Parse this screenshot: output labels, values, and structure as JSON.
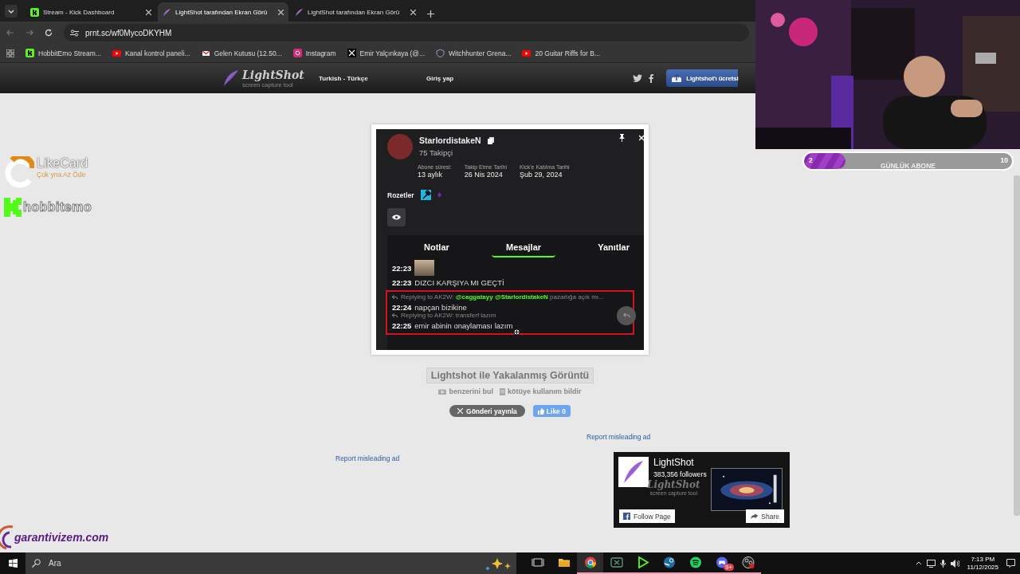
{
  "browser": {
    "tabs": [
      {
        "label": "Stream - Kick Dashboard",
        "kind": "kick",
        "selected": false
      },
      {
        "label": "LightShot tarafından Ekran Görü",
        "kind": "feather",
        "selected": true
      },
      {
        "label": "LightShot tarafından Ekran Görü",
        "kind": "feather",
        "selected": false
      }
    ],
    "url": "prnt.sc/wf0MycoDKYHM",
    "bookmarks": [
      {
        "label": "HobbitEmo Stream...",
        "kind": "kick"
      },
      {
        "label": "Kanal kontrol paneli...",
        "kind": "youtube"
      },
      {
        "label": "Gelen Kutusu (12.50...",
        "kind": "gmail"
      },
      {
        "label": "Instagram",
        "kind": "instagram"
      },
      {
        "label": "Emir Yalçınkaya (@...",
        "kind": "x"
      },
      {
        "label": "Witchhunter Grena...",
        "kind": "shield"
      },
      {
        "label": "20 Guitar Riffs for B...",
        "kind": "youtube"
      }
    ]
  },
  "site_header": {
    "logo": "LightShot",
    "tagline": "screen capture tool",
    "language": "Turkish - Türkçe",
    "login": "Giriş yap",
    "cta": "Lightshot'ı ücretsi"
  },
  "screenshot": {
    "user": "StarlordistakeN",
    "followers": "75 Takipçi",
    "stats": [
      {
        "label": "Abone süresi:",
        "value": "13 aylık"
      },
      {
        "label": "Takip Etme Tarihi",
        "value": "26 Nis 2024"
      },
      {
        "label": "Kick'e Katılma Tarihi",
        "value": "Şub 29, 2024"
      }
    ],
    "badges_label": "Rozetler",
    "tabs": [
      {
        "label": "Notlar",
        "selected": false
      },
      {
        "label": "Mesajlar",
        "selected": true
      },
      {
        "label": "Yanıtlar",
        "selected": false
      }
    ],
    "messages": [
      {
        "time": "22:23"
      },
      {
        "time": "22:23",
        "kind": "text",
        "text": "DIZCI KARŞIYA MI GEÇTİ"
      }
    ],
    "highlighted_messages": [
      {
        "reply": "Replying to AK2W: **@caggatayy @StarlordistakeN** pazarlığa açık mı...",
        "time": "22:24",
        "text": "napçan bizikine"
      },
      {
        "reply": "Replying to AK2W: transferf lazım",
        "time": "22:25",
        "text": "emir abinin onaylaması lazım"
      }
    ]
  },
  "caption": "Lightshot ile Yakalanmış Görüntü",
  "actions": [
    {
      "label": "benzerini bul",
      "kind": "camera"
    },
    {
      "label": "kötüye kullanım bildir",
      "kind": "flag"
    }
  ],
  "tweet_button": "Gönderi yayınla",
  "like_button": "Like 0",
  "report_ads": [
    "Report misleading ad",
    "Report misleading ad"
  ],
  "facebook": {
    "name": "LightShot",
    "followers": "383,356 followers",
    "logo_text": "LightShot",
    "logo_tagline": "screen capture tool",
    "follow": "Follow Page",
    "share": "Share"
  },
  "overlays": {
    "likecard": "LikeCard",
    "likecard_slogan": "Çok yna Az Öde",
    "channel": "hobbitemo",
    "sponsor": "garantivizem.com"
  },
  "webcam": {
    "kind": "picture"
  },
  "sub_goal": {
    "count": "2",
    "label": "GÜNLÜK ABONE",
    "target": "10",
    "level": 0.2
  },
  "taskbar": {
    "search": "Ara",
    "apps": [
      {
        "kind": "taskview",
        "running": false,
        "active": false
      },
      {
        "kind": "folder",
        "running": false,
        "active": false
      },
      {
        "kind": "chrome",
        "running": true,
        "active": true
      },
      {
        "kind": "xbox",
        "running": true,
        "active": false
      },
      {
        "kind": "kick",
        "running": true,
        "active": false
      },
      {
        "kind": "steam",
        "running": true,
        "active": false
      },
      {
        "kind": "spotify",
        "running": true,
        "active": false
      },
      {
        "kind": "discord",
        "running": true,
        "active": false,
        "badge": "9+"
      },
      {
        "kind": "obs",
        "running": true,
        "active": false
      }
    ],
    "time": "7:13 PM",
    "date": "11/12/2025"
  }
}
